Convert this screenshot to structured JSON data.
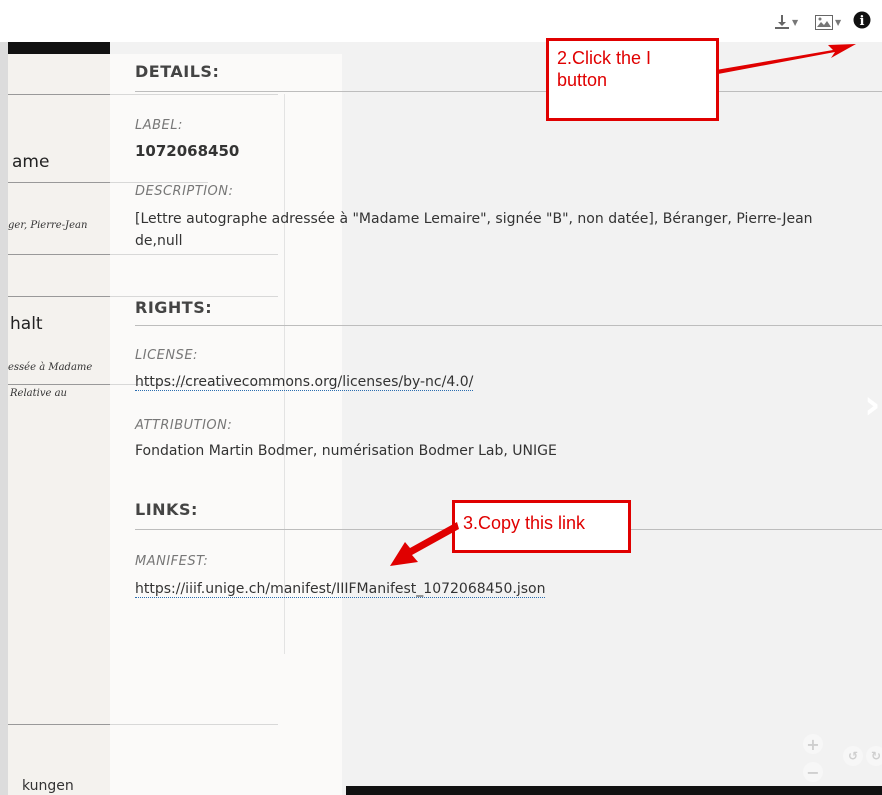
{
  "toolbar": {
    "download_icon": "download-icon",
    "image_icon": "image-icon",
    "info_icon": "info-icon",
    "info_glyph": "i"
  },
  "document": {
    "fragment_1": "ame",
    "fragment_2": "ger, Pierre-Jean",
    "fragment_3": "halt",
    "fragment_4": "essée à Madame",
    "fragment_5": "Relative au",
    "fragment_6": "kungen"
  },
  "details": {
    "title": "DETAILS:",
    "label_caption": "LABEL:",
    "label_value": "1072068450",
    "description_caption": "DESCRIPTION:",
    "description_value": "[Lettre autographe adressée à \"Madame Lemaire\", signée \"B\", non datée], Béranger, Pierre-Jean de,null"
  },
  "rights": {
    "title": "RIGHTS:",
    "license_caption": "LICENSE:",
    "license_value": "https://creativecommons.org/licenses/by-nc/4.0/",
    "attribution_caption": "ATTRIBUTION:",
    "attribution_value": "Fondation Martin Bodmer, numérisation Bodmer Lab, UNIGE"
  },
  "links": {
    "title": "LINKS:",
    "manifest_caption": "MANIFEST:",
    "manifest_value": "https://iiif.unige.ch/manifest/IIIFManifest_1072068450.json"
  },
  "annotations": {
    "callout_2_line1": "2.Click the I",
    "callout_2_line2": "button",
    "callout_3": "3.Copy this link",
    "color": "#e00000"
  },
  "viewer_controls": {
    "zoom_in": "+",
    "zoom_out": "−",
    "next_glyph": "›"
  }
}
